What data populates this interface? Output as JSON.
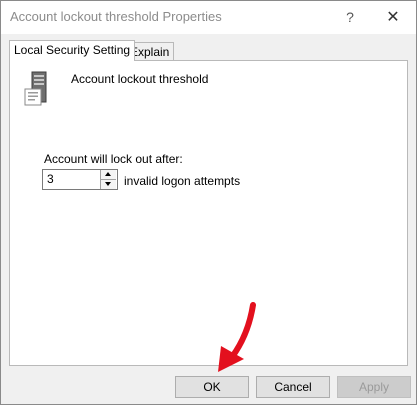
{
  "window": {
    "title": "Account lockout threshold Properties",
    "help_glyph": "?",
    "close_glyph": "✕"
  },
  "tabs": [
    {
      "label": "Local Security Setting",
      "selected": true
    },
    {
      "label": "Explain",
      "selected": false
    }
  ],
  "policy": {
    "icon": "server-icon",
    "name": "Account lockout threshold"
  },
  "lockout": {
    "label": "Account will lock out after:",
    "value": "3",
    "suffix": "invalid logon attempts"
  },
  "buttons": {
    "ok": "OK",
    "cancel": "Cancel",
    "apply": "Apply"
  },
  "annotation": {
    "type": "red-arrow-pointing-to-ok",
    "color": "#e3101e"
  }
}
